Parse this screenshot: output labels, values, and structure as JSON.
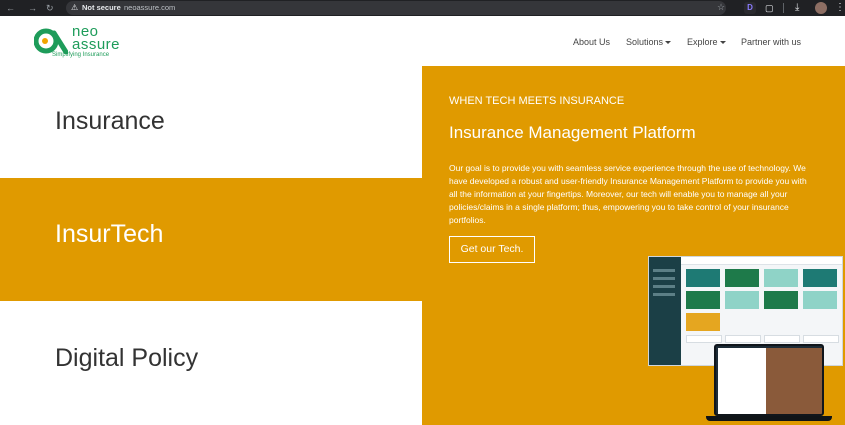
{
  "browser": {
    "security_label": "Not secure",
    "url": "neoassure.com",
    "extension_letter": "D"
  },
  "brand": {
    "logo_line1": "neo",
    "logo_line2": "assure",
    "tagline": "Simplifying Insurance",
    "green": "#1e9c5a"
  },
  "nav": {
    "items": [
      {
        "label": "About Us",
        "has_dropdown": false
      },
      {
        "label": "Solutions",
        "has_dropdown": true
      },
      {
        "label": "Explore",
        "has_dropdown": true
      },
      {
        "label": "Partner with us",
        "has_dropdown": false
      }
    ]
  },
  "bands": [
    {
      "title": "Insurance",
      "color": "#333333",
      "background": "#ffffff"
    },
    {
      "title": "InsurTech",
      "color": "#ffffff",
      "background": "#e09a00"
    },
    {
      "title": "Digital Policy",
      "color": "#333333",
      "background": "#ffffff"
    }
  ],
  "hero": {
    "eyebrow": "WHEN TECH MEETS INSURANCE",
    "headline": "Insurance Management Platform",
    "paragraph": "Our goal is to provide you with seamless service experience through the use of technology. We have developed a robust and user-friendly Insurance Management Platform to provide you with all the information at your fingertips. Moreover, our tech will enable you to manage all your policies/claims in a single platform; thus, empowering you to take control of your insurance portfolios.",
    "cta_label": "Get our Tech.",
    "background": "#e09a00"
  }
}
